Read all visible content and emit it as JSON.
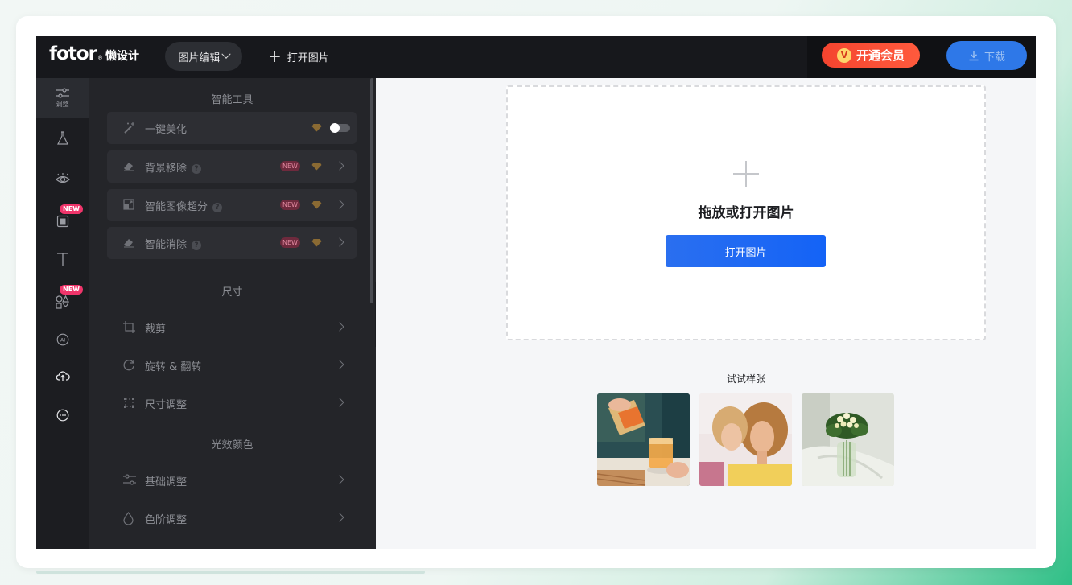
{
  "header": {
    "logo_brand": "fotor",
    "logo_sup": "®",
    "logo_sub": "懒设计",
    "menu_label": "图片编辑",
    "open_label": "打开图片",
    "vip_badge": "V",
    "vip_label": "开通会员",
    "download_label": "下载"
  },
  "rail": {
    "items": [
      {
        "id": "adjust",
        "label": "调整",
        "icon": "sliders-icon",
        "active": true
      },
      {
        "id": "effects",
        "icon": "flask-icon"
      },
      {
        "id": "beauty",
        "icon": "eye-icon"
      },
      {
        "id": "frame",
        "icon": "frame-icon",
        "badge": "NEW"
      },
      {
        "id": "text",
        "icon": "text-icon"
      },
      {
        "id": "elements",
        "icon": "shapes-icon",
        "badge": "NEW"
      },
      {
        "id": "ai",
        "icon": "ai-icon"
      },
      {
        "id": "upload",
        "icon": "cloud-upload-icon"
      },
      {
        "id": "more",
        "icon": "more-icon"
      }
    ]
  },
  "panel": {
    "sections": [
      {
        "title": "智能工具"
      },
      {
        "title": "尺寸"
      },
      {
        "title": "光效颜色"
      }
    ],
    "ai_tools": [
      {
        "name": "一键美化",
        "icon": "magic-wand-icon",
        "toggle": true
      },
      {
        "name": "背景移除",
        "icon": "eraser-icon",
        "badge": "NEW"
      },
      {
        "name": "智能图像超分",
        "icon": "upscale-icon",
        "badge": "NEW"
      },
      {
        "name": "智能消除",
        "icon": "eraser-icon",
        "badge": "NEW"
      }
    ],
    "size_tools": [
      {
        "name": "裁剪",
        "icon": "crop-icon"
      },
      {
        "name": "旋转 & 翻转",
        "icon": "rotate-icon"
      },
      {
        "name": "尺寸调整",
        "icon": "resize-icon"
      }
    ],
    "color_tools": [
      {
        "name": "基础调整",
        "icon": "sliders-icon"
      },
      {
        "name": "色阶调整",
        "icon": "drop-icon"
      }
    ],
    "help_glyph": "?"
  },
  "canvas": {
    "drop_title": "拖放或打开图片",
    "open_button": "打开图片",
    "try_title": "试试样张",
    "samples": [
      {
        "id": "sample-juice",
        "icon": "photo-juice"
      },
      {
        "id": "sample-women",
        "icon": "photo-women"
      },
      {
        "id": "sample-flowers",
        "icon": "photo-flowers"
      }
    ]
  },
  "colors": {
    "accent": "#1463f6",
    "vip": "#f4442f",
    "new_badge": "#f0356b",
    "topbar": "#17181c",
    "panel": "#242529"
  }
}
